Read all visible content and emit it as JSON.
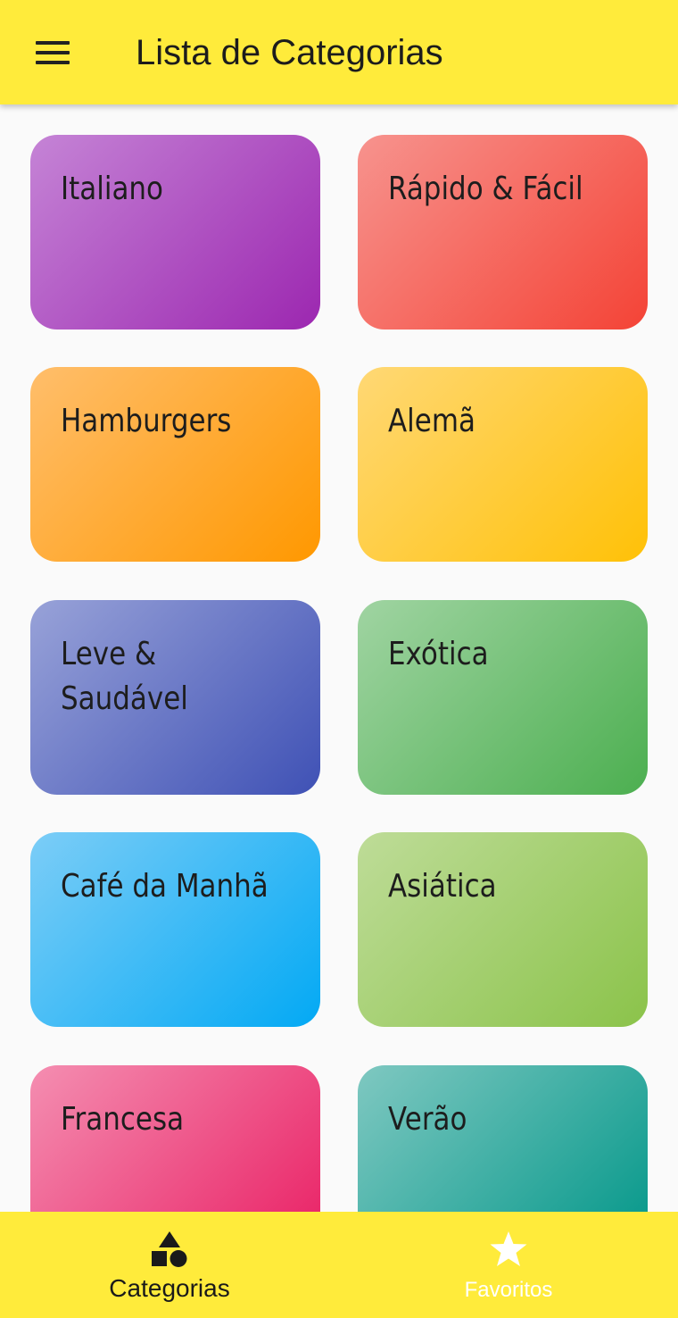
{
  "appbar": {
    "title": "Lista de Categorias",
    "menu_icon": "menu-icon"
  },
  "categories": [
    {
      "title": "Italiano",
      "color_from": "#c584d6",
      "color_to": "#9c27b0"
    },
    {
      "title": "Rápido & Fácil",
      "color_from": "#f7938e",
      "color_to": "#f44336"
    },
    {
      "title": "Hamburgers",
      "color_from": "#ffbe6b",
      "color_to": "#ff9800"
    },
    {
      "title": "Alemã",
      "color_from": "#ffd875",
      "color_to": "#ffc107"
    },
    {
      "title": "Leve & Saudável",
      "color_from": "#98a2d8",
      "color_to": "#3f51b5"
    },
    {
      "title": "Exótica",
      "color_from": "#a0d4a2",
      "color_to": "#4caf50"
    },
    {
      "title": "Café da Manhã",
      "color_from": "#7ccdf7",
      "color_to": "#03a9f4"
    },
    {
      "title": "Asiática",
      "color_from": "#bedc98",
      "color_to": "#8bc34a"
    },
    {
      "title": "Francesa",
      "color_from": "#f48eb1",
      "color_to": "#e91e63"
    },
    {
      "title": "Verão",
      "color_from": "#7fc8c1",
      "color_to": "#009688"
    }
  ],
  "bottom_nav": {
    "tabs": [
      {
        "label": "Categorias",
        "icon": "category-icon",
        "selected": true
      },
      {
        "label": "Favoritos",
        "icon": "star-icon",
        "selected": false
      }
    ],
    "background": "#ffeb3b"
  },
  "colors": {
    "appbar": "#ffeb3b",
    "page_background": "#fafafa"
  }
}
